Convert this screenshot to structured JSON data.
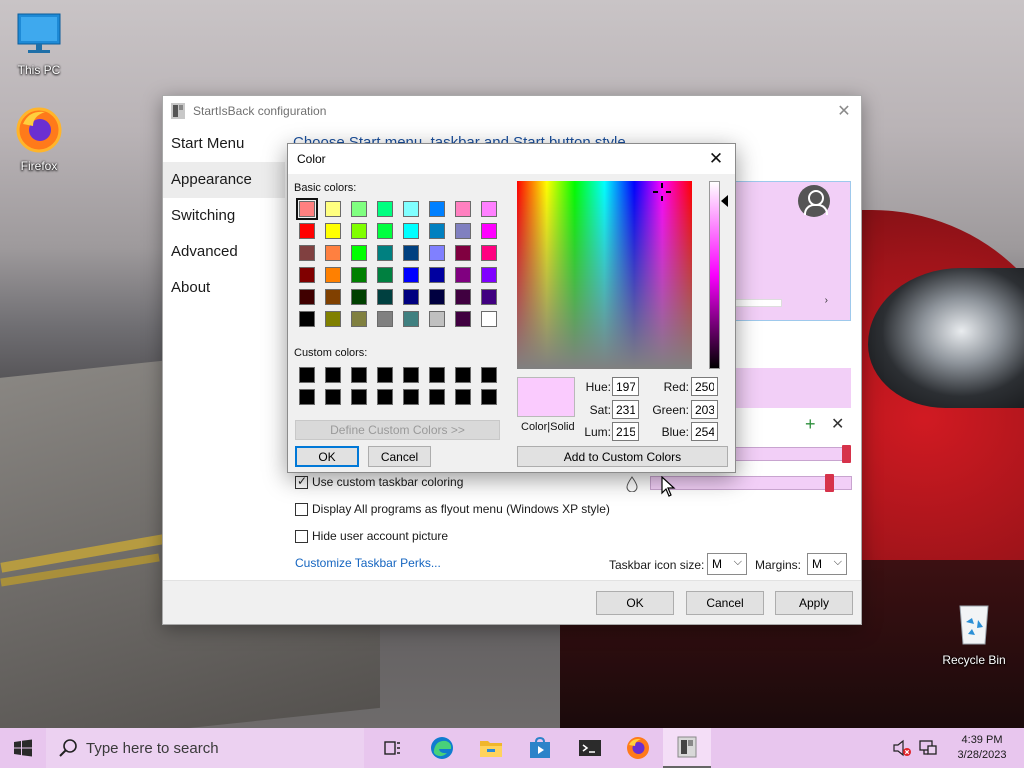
{
  "desktop": {
    "icons": [
      {
        "label": "This PC"
      },
      {
        "label": "Firefox"
      },
      {
        "label": "Recycle Bin"
      }
    ]
  },
  "sib": {
    "title": "StartIsBack configuration",
    "nav": [
      "Start Menu",
      "Appearance",
      "Switching",
      "Advanced",
      "About"
    ],
    "selected_nav": "Appearance",
    "heading": "Choose Start menu, taskbar and Start button style",
    "options": {
      "custom_taskbar": "Use custom taskbar coloring",
      "xp_flyout": "Display All programs as flyout menu (Windows XP style)",
      "hide_picture": "Hide user account picture"
    },
    "checked": {
      "custom_taskbar": true,
      "xp_flyout": false,
      "hide_picture": false
    },
    "link": "Customize Taskbar Perks...",
    "taskbar_icon_size_label": "Taskbar icon size:",
    "taskbar_icon_size": "M",
    "margins_label": "Margins:",
    "margins": "M",
    "buttons": {
      "ok": "OK",
      "cancel": "Cancel",
      "apply": "Apply"
    },
    "preview_color": "#f2cff7",
    "accent": "#d6324a"
  },
  "color_dialog": {
    "title": "Color",
    "basic_colors_label": "Basic colors:",
    "custom_colors_label": "Custom colors:",
    "basic_colors": [
      "#ff8080",
      "#ffff80",
      "#80ff80",
      "#00ff80",
      "#80ffff",
      "#0080ff",
      "#ff80c0",
      "#ff80ff",
      "#ff0000",
      "#ffff00",
      "#80ff00",
      "#00ff40",
      "#00ffff",
      "#0080c0",
      "#8080c0",
      "#ff00ff",
      "#804040",
      "#ff8040",
      "#00ff00",
      "#008080",
      "#004080",
      "#8080ff",
      "#800040",
      "#ff0080",
      "#800000",
      "#ff8000",
      "#008000",
      "#008040",
      "#0000ff",
      "#0000a0",
      "#800080",
      "#8000ff",
      "#400000",
      "#804000",
      "#004000",
      "#004040",
      "#000080",
      "#000040",
      "#400040",
      "#400080",
      "#000000",
      "#808000",
      "#808040",
      "#808080",
      "#408080",
      "#c0c0c0",
      "#400040",
      "#ffffff"
    ],
    "custom_colors": [
      "#000000",
      "#000000",
      "#000000",
      "#000000",
      "#000000",
      "#000000",
      "#000000",
      "#000000",
      "#000000",
      "#000000",
      "#000000",
      "#000000",
      "#000000",
      "#000000",
      "#000000",
      "#000000"
    ],
    "define_custom": "Define Custom Colors >>",
    "ok": "OK",
    "cancel": "Cancel",
    "color_solid": "Color|Solid",
    "hue_label": "Hue:",
    "hue": "197",
    "sat_label": "Sat:",
    "sat": "231",
    "lum_label": "Lum:",
    "lum": "215",
    "red_label": "Red:",
    "red": "250",
    "green_label": "Green:",
    "green": "203",
    "blue_label": "Blue:",
    "blue": "254",
    "add_custom": "Add to Custom Colors",
    "current_color": "#facbfe"
  },
  "taskbar": {
    "search_placeholder": "Type here to search",
    "time": "4:39 PM",
    "date": "3/28/2023",
    "color": "#e8c6ee"
  }
}
